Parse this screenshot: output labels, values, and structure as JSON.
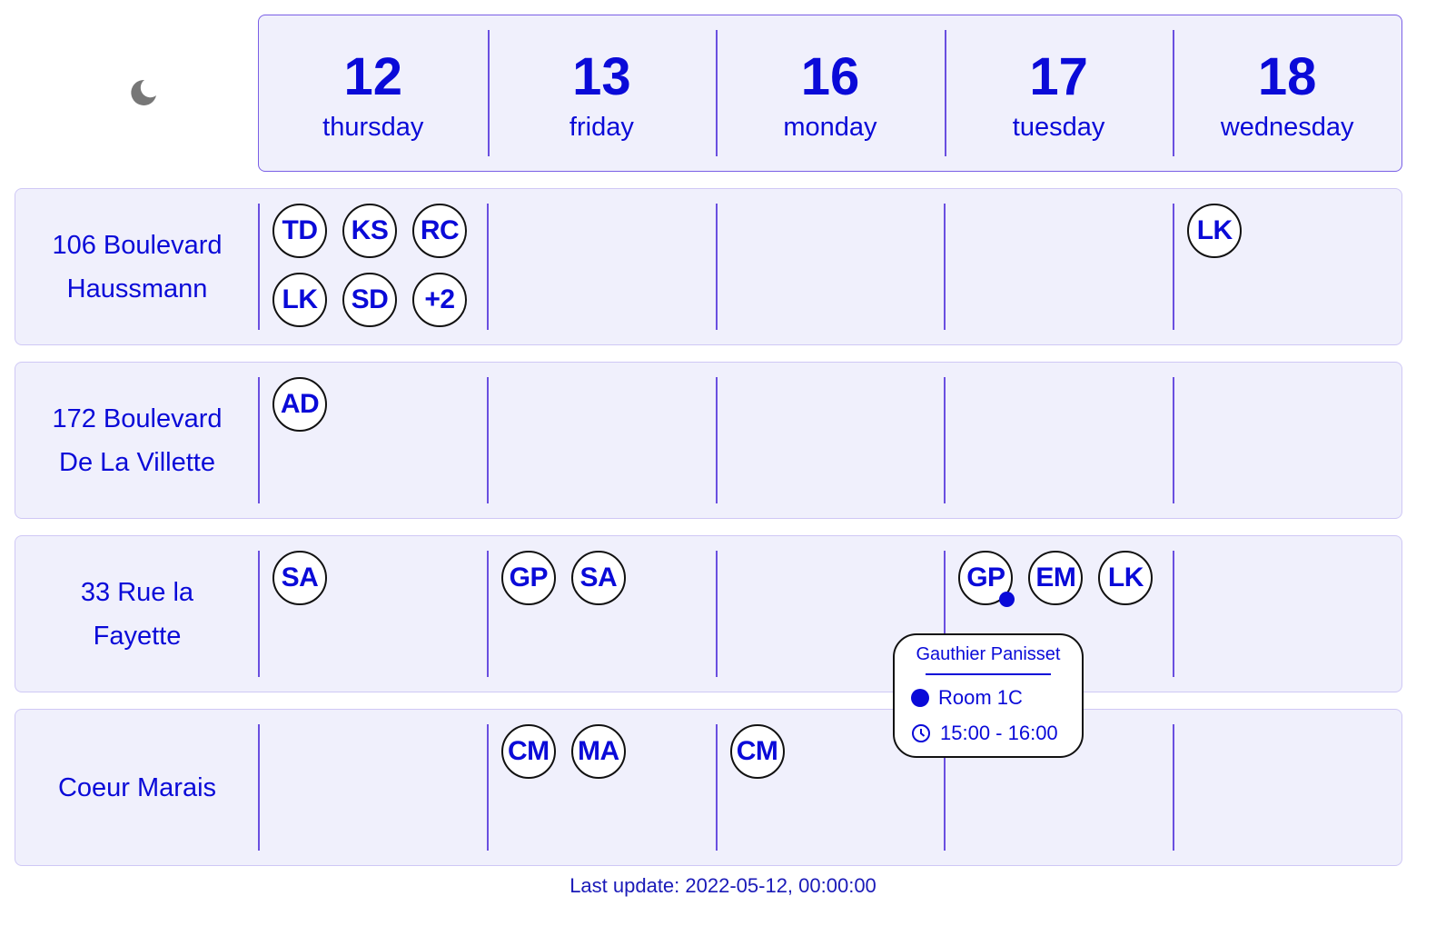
{
  "theme_toggle": {
    "icon": "moon-icon",
    "color": "#777777"
  },
  "days": [
    {
      "number": "12",
      "name": "thursday"
    },
    {
      "number": "13",
      "name": "friday"
    },
    {
      "number": "16",
      "name": "monday"
    },
    {
      "number": "17",
      "name": "tuesday"
    },
    {
      "number": "18",
      "name": "wednesday"
    }
  ],
  "locations": [
    {
      "name_line1": "106 Boulevard",
      "name_line2": "Haussmann",
      "cells": [
        [
          "TD",
          "KS",
          "RC",
          "LK",
          "SD",
          "+2"
        ],
        [],
        [],
        [],
        [
          "LK"
        ]
      ]
    },
    {
      "name_line1": "172 Boulevard",
      "name_line2": "De La Villette",
      "cells": [
        [
          "AD"
        ],
        [],
        [],
        [],
        []
      ]
    },
    {
      "name_line1": "33 Rue la",
      "name_line2": "Fayette",
      "cells": [
        [
          "SA"
        ],
        [
          "GP",
          "SA"
        ],
        [],
        [
          "GP",
          "EM",
          "LK"
        ],
        []
      ]
    },
    {
      "name_line1": "Coeur Marais",
      "name_line2": "",
      "cells": [
        [],
        [
          "CM",
          "MA"
        ],
        [
          "CM"
        ],
        [],
        []
      ]
    }
  ],
  "tooltip": {
    "name": "Gauthier Panisset",
    "room": "Room 1C",
    "time": "15:00 - 16:00",
    "room_icon": "dot-icon",
    "time_icon": "clock-icon"
  },
  "footer": {
    "text": "Last update: 2022-05-12, 00:00:00"
  },
  "colors": {
    "accent": "#0a0ad8",
    "divider": "#6a4fe0",
    "panel": "#f0f0fc"
  }
}
